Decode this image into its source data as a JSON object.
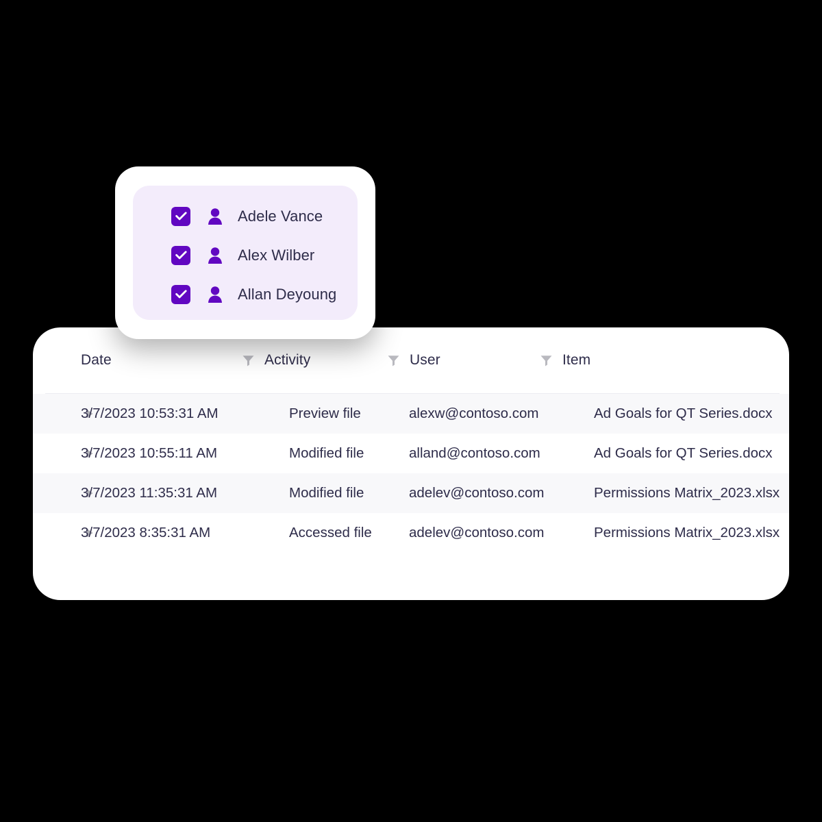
{
  "people_picker": {
    "people": [
      {
        "name": "Adele Vance",
        "checked": true,
        "icon": "person-icon"
      },
      {
        "name": "Alex Wilber",
        "checked": true,
        "icon": "person-icon"
      },
      {
        "name": "Allan Deyoung",
        "checked": true,
        "icon": "person-icon"
      }
    ],
    "accent_color": "#6107C1",
    "panel_color": "#F3ECFB"
  },
  "activity_table": {
    "columns": [
      {
        "label": "Date",
        "has_filter": false
      },
      {
        "label": "Activity",
        "has_filter": true
      },
      {
        "label": "User",
        "has_filter": true
      },
      {
        "label": "Item",
        "has_filter": true
      }
    ],
    "rows": [
      {
        "date": "3/7/2023 10:53:31 AM",
        "activity": "Preview file",
        "user": "alexw@contoso.com",
        "item": "Ad Goals for QT Series.docx"
      },
      {
        "date": "3/7/2023 10:55:11 AM",
        "activity": "Modified file",
        "user": "alland@contoso.com",
        "item": "Ad Goals for QT Series.docx"
      },
      {
        "date": "3/7/2023 11:35:31 AM",
        "activity": "Modified file",
        "user": "adelev@contoso.com",
        "item": "Permissions Matrix_2023.xlsx"
      },
      {
        "date": "3/7/2023 8:35:31 AM",
        "activity": "Accessed file",
        "user": "adelev@contoso.com",
        "item": "Permissions Matrix_2023.xlsx"
      }
    ],
    "text_color": "#2E2C4A",
    "stripe_color": "#F8F8FA",
    "filter_icon_color": "#B9B9BF"
  }
}
